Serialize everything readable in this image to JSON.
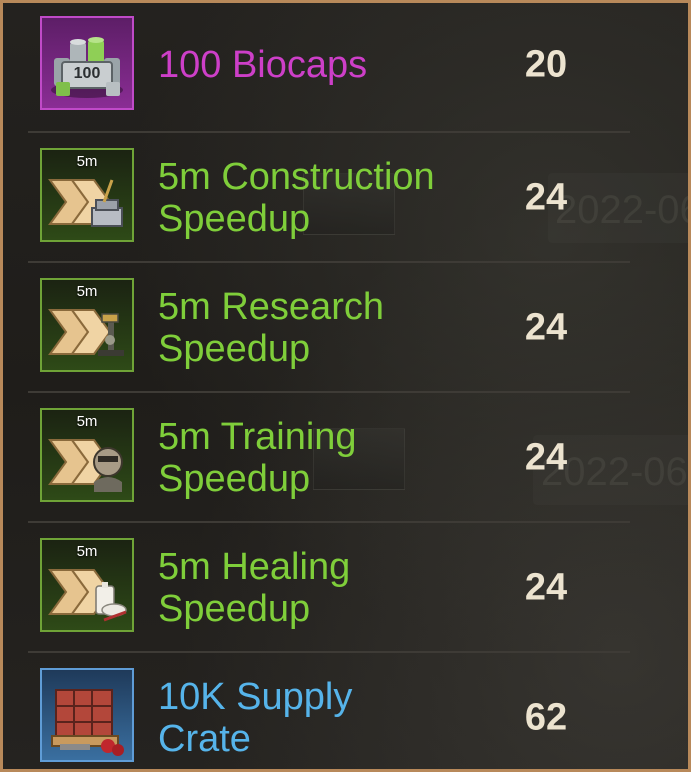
{
  "background": {
    "stamp_text": "2022-06"
  },
  "colors": {
    "frame": "#b8895a",
    "epic": "#cd3fc8",
    "uncommon": "#7fce3a",
    "rare": "#56b4ea",
    "quantity": "#ece3cf"
  },
  "items": [
    {
      "name_line1": "100 Biocaps",
      "name_line2": "",
      "quantity": "20",
      "rarity": "purple",
      "icon": "biocaps-icon",
      "icon_text": "100"
    },
    {
      "name_line1": "5m Construction",
      "name_line2": "Speedup",
      "quantity": "24",
      "rarity": "green",
      "icon": "construction-speedup-icon",
      "icon_text": "5m"
    },
    {
      "name_line1": "5m Research",
      "name_line2": "Speedup",
      "quantity": "24",
      "rarity": "green",
      "icon": "research-speedup-icon",
      "icon_text": "5m"
    },
    {
      "name_line1": "5m Training",
      "name_line2": "Speedup",
      "quantity": "24",
      "rarity": "green",
      "icon": "training-speedup-icon",
      "icon_text": "5m"
    },
    {
      "name_line1": "5m Healing",
      "name_line2": "Speedup",
      "quantity": "24",
      "rarity": "green",
      "icon": "healing-speedup-icon",
      "icon_text": "5m"
    },
    {
      "name_line1": "10K Supply",
      "name_line2": "Crate",
      "quantity": "62",
      "rarity": "blue",
      "icon": "supply-crate-icon",
      "icon_text": ""
    }
  ]
}
